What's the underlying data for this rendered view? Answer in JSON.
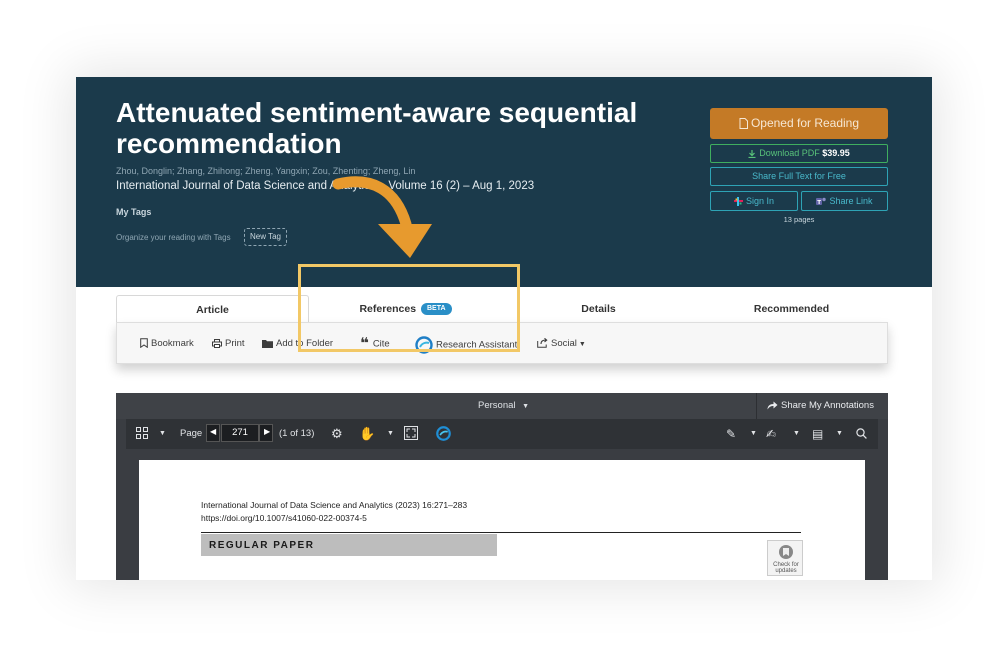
{
  "article": {
    "title": "Attenuated sentiment-aware sequential recommendation",
    "authors": "Zhou, Donglin; Zhang, Zhihong; Zheng, Yangxin; Zou, Zhenting; Zheng, Lin",
    "journal": "International Journal of Data Science and Analytics – Volume 16 (2) – Aug 1, 2023",
    "my_tags_label": "My Tags",
    "organize_text": "Organize your reading with Tags",
    "new_tag": "New Tag"
  },
  "actions": {
    "opened": "Opened for Reading",
    "download": "Download PDF",
    "price": "$39.95",
    "share_full": "Share Full Text for Free",
    "sign_in": "Sign In",
    "share_link": "Share Link",
    "pages": "13 pages"
  },
  "tabs": [
    {
      "label": "Article"
    },
    {
      "label": "References",
      "badge": "BETA"
    },
    {
      "label": "Details"
    },
    {
      "label": "Recommended"
    }
  ],
  "toolbar": {
    "bookmark": "Bookmark",
    "print": "Print",
    "add_to_folder": "Add to Folder",
    "cite": "Cite",
    "research_assistant": "Research Assistant",
    "social": "Social"
  },
  "viewer": {
    "annotation_scope": "Personal",
    "share_annotations": "Share My Annotations",
    "page_label": "Page",
    "page_value": "271",
    "page_of": "(1 of 13)"
  },
  "document": {
    "journal_line": "International Journal of Data Science and Analytics (2023) 16:271–283",
    "doi": "https://doi.org/10.1007/s41060-022-00374-5",
    "paper_type": "REGULAR PAPER",
    "check_updates": "Check for updates"
  },
  "colors": {
    "header_bg": "#1b3a4b",
    "opened_button": "#c47a26",
    "download_green": "#3fae5f",
    "teal": "#2ea3b5",
    "highlight": "#f2c866",
    "arrow": "#e79a2e"
  }
}
